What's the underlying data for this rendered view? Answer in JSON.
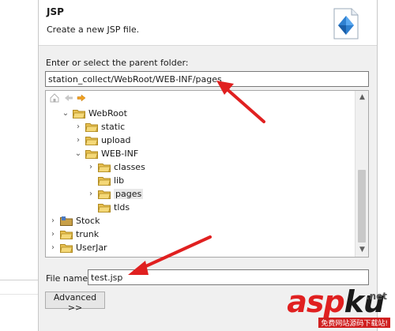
{
  "header": {
    "title": "JSP",
    "description": "Create a new JSP file."
  },
  "parent_folder": {
    "label": "Enter or select the parent folder:",
    "value": "station_collect/WebRoot/WEB-INF/pages"
  },
  "tree": {
    "items": [
      {
        "label": "WebRoot",
        "expanded": true
      },
      {
        "label": "static",
        "expanded": false
      },
      {
        "label": "upload",
        "expanded": false
      },
      {
        "label": "WEB-INF",
        "expanded": true
      },
      {
        "label": "classes",
        "expanded": false
      },
      {
        "label": "lib",
        "expanded": false
      },
      {
        "label": "pages",
        "expanded": false,
        "selected": true
      },
      {
        "label": "tlds",
        "expanded": false
      },
      {
        "label": "Stock",
        "expanded": false
      },
      {
        "label": "trunk",
        "expanded": false
      },
      {
        "label": "UserJar",
        "expanded": false
      }
    ]
  },
  "file_name": {
    "label": "File name:",
    "value": "test.jsp"
  },
  "advanced_button": {
    "label": "Advanced >>"
  },
  "watermark": {
    "brand_red": "asp",
    "brand_black": "ku",
    "suffix": ".net",
    "subtitle": "免费网站源码下载站!"
  },
  "colors": {
    "folder_yellow": "#e8c050",
    "arrow_red": "#e02020",
    "toolbar_orange": "#f0a020"
  }
}
